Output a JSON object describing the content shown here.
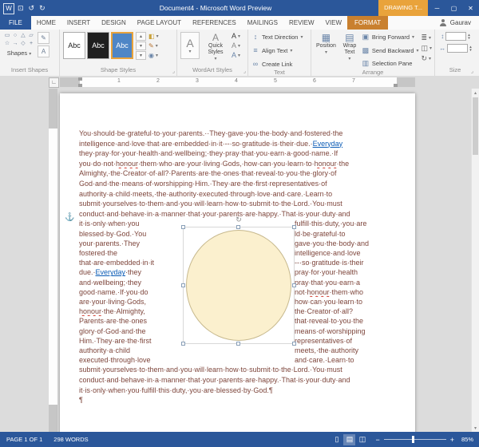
{
  "colors": {
    "titlebar": "#2B579A",
    "contextual": "#E9A33B",
    "format_tab": "#C9802F",
    "page_text": "#7E463C",
    "shape_fill": "#FBF0CE",
    "hyperlink": "#0B5BB5",
    "misspell": "#D23A2E"
  },
  "title_bar": {
    "title": "Document4 - Microsoft Word Preview",
    "contextual_group": "DRAWING T..."
  },
  "tabs": {
    "file": "FILE",
    "items": [
      "HOME",
      "INSERT",
      "DESIGN",
      "PAGE LAYOUT",
      "REFERENCES",
      "MAILINGS",
      "REVIEW",
      "VIEW"
    ],
    "contextual": "FORMAT",
    "user": "Gaurav"
  },
  "ribbon": {
    "insert_shapes": {
      "label": "Insert Shapes",
      "button": "Shapes"
    },
    "shape_styles": {
      "label": "Shape Styles",
      "presets": [
        "Abc",
        "Abc",
        "Abc"
      ]
    },
    "wordart_styles": {
      "label": "WordArt Styles",
      "quick_styles": "Quick Styles"
    },
    "text": {
      "label": "Text",
      "items": [
        {
          "icon": "text_direction",
          "label": "Text Direction",
          "caret": true
        },
        {
          "icon": "align_text",
          "label": "Align Text",
          "caret": true
        },
        {
          "icon": "create_link",
          "label": "Create Link",
          "caret": false
        }
      ]
    },
    "arrange": {
      "label": "Arrange",
      "big": [
        {
          "label": "Position"
        },
        {
          "label": "Wrap Text"
        }
      ],
      "items": [
        {
          "icon": "bring_forward",
          "label": "Bring Forward",
          "caret": true
        },
        {
          "icon": "send_backward",
          "label": "Send Backward",
          "caret": true
        },
        {
          "icon": "selection_pane",
          "label": "Selection Pane",
          "caret": false
        }
      ]
    },
    "size": {
      "label": "Size"
    }
  },
  "ruler": {
    "numbers": [
      "1",
      "2",
      "3",
      "4",
      "5",
      "6",
      "7"
    ]
  },
  "document": {
    "hyperlink_word": "Everyday",
    "misspelled_word": "honour",
    "para_top_lines": [
      "You·should·be·grateful·to·your·parents.··They·gave·you·the·body·and·fostered·the",
      "intelligence·and·love·that·are·embedded·in·it·--·so·gratitude·is·their·due.·Everyday",
      "they·pray·for·your·health·and·wellbeing;·they·pray·that·you·earn·a·good·name.·If",
      "you·do·not·honour·them·who·are·your·living·Gods,·how·can·you·learn·to·honour·the",
      "Almighty,·the·Creator·of·all?·Parents·are·the·ones·that·reveal·to·you·the·glory·of",
      "God·and·the·means·of·worshipping·Him.·They·are·the·first·representatives·of",
      "authority·a·child·meets,·the·authority·executed·through·love·and·care.·Learn·to",
      "submit·yourselves·to·them·and·you·will·learn·how·to·submit·to·the·Lord.·You·must",
      "conduct·and·behave·in·a·manner·that·your·parents·are·happy.·That·is·your·duty·and"
    ],
    "wrap_left_lines": [
      "it·is·only·when·you",
      "blessed·by·God.·You",
      "your·parents.·They",
      "fostered·the",
      "that·are·embedded·in·it",
      "due.·Everyday·they",
      "and·wellbeing;·they",
      "good·name.·If·you·do",
      "are·your·living·Gods,",
      "honour·the·Almighty,",
      "Parents·are·the·ones",
      "glory·of·God·and·the",
      "Him.·They·are·the·first",
      "authority·a·child",
      "executed·through·love"
    ],
    "wrap_right_lines": [
      "fulfill·this·duty,·you·are",
      "ld·be·grateful·to",
      "gave·you·the·body·and",
      "intelligence·and·love",
      "--·so·gratitude·is·their",
      "pray·for·your·health",
      "pray·that·you·earn·a",
      "not·honour·them·who",
      "how·can·you·learn·to",
      "the·Creator·of·all?",
      "that·reveal·to·you·the",
      "means·of·worshipping",
      "representatives·of",
      "meets,·the·authority",
      "and·care.·Learn·to"
    ],
    "para_bottom_lines": [
      "submit·yourselves·to·them·and·you·will·learn·how·to·submit·to·the·Lord.·You·must",
      "conduct·and·behave·in·a·manner·that·your·parents·are·happy.·That·is·your·duty·and",
      "it·is·only·when·you·fulfill·this·duty,·you·are·blessed·by·God.¶"
    ],
    "empty_para": "¶"
  },
  "status_bar": {
    "page": "PAGE 1 OF 1",
    "words": "298 WORDS",
    "zoom": "85%"
  },
  "icons": {
    "app": "W",
    "save": "⊡",
    "undo": "↺",
    "redo": "↻",
    "caret": "▾",
    "window_min": "─",
    "window_max": "▢",
    "window_close": "✕",
    "shape_gallery": [
      "▭",
      "○",
      "△",
      "▱",
      "☆",
      "→",
      "◇",
      "+"
    ],
    "edit_shape": "✎",
    "draw_textbox": "A",
    "gallery_up": "▴",
    "gallery_down": "▾",
    "gallery_more": "▾",
    "shape_fill": "◧",
    "shape_outline": "✎",
    "shape_effects": "◉",
    "wordart_a": "A",
    "text_fill_a": "A",
    "text_outline_a": "A",
    "text_effects_a": "A",
    "text_direction": "↕",
    "align_text": "≡",
    "create_link": "∞",
    "position": "▦",
    "wrap_text": "▤",
    "bring_forward": "▣",
    "send_backward": "▩",
    "selection_pane": "▥",
    "align_objects": "≣",
    "group_objects": "◫",
    "rotate_objects": "↻",
    "size_height": "↕",
    "size_width": "↔",
    "launcher": "⌟",
    "tab_selector": "∟",
    "anchor": "⚓",
    "rotate_handle": "↻",
    "view_read": "▯",
    "view_print": "▤",
    "view_web": "◫",
    "zoom_out": "−",
    "zoom_in": "+",
    "scroll_up": "▴",
    "scroll_down": "▾"
  }
}
